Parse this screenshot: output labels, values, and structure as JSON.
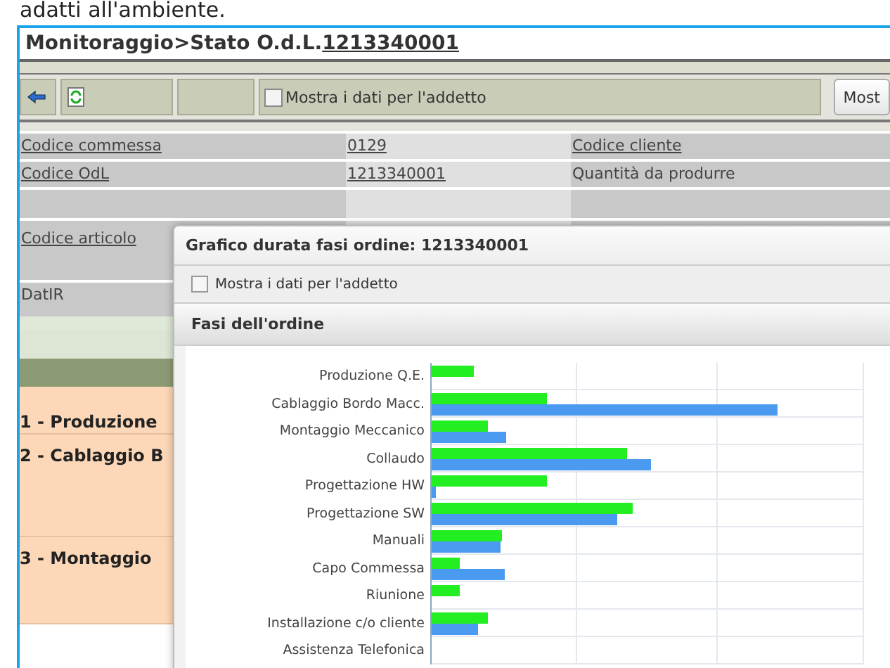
{
  "caption": "adatti all'ambiente.",
  "page_title": {
    "prefix": "Monitoraggio>Stato O.d.L.",
    "order_number": "1213340001"
  },
  "toolbar": {
    "checkbox": {
      "label": "Mostra i dati per l'addetto",
      "checked": false
    },
    "button": "Most"
  },
  "info_rows": [
    {
      "label": {
        "text": "Codice commessa",
        "linked": true
      },
      "value": "0129",
      "label_2": {
        "text": "Codice cliente",
        "linked": true
      }
    },
    {
      "label": {
        "text": "Codice OdL",
        "linked": true
      },
      "value": "1213340001",
      "label_2": {
        "text": "Quantità da produrre",
        "linked": false
      }
    },
    {},
    {
      "label": {
        "text": "Codice articolo",
        "linked": true
      }
    },
    {
      "label": {
        "text": "DatIR",
        "linked": false
      }
    }
  ],
  "phases": [
    "1 - Produzione",
    "2 - Cablaggio B",
    "3 - Montaggio"
  ],
  "dialog": {
    "title": "Grafico durata fasi ordine: 1213340001",
    "checkbox": {
      "label": "Mostra i dati per l'addetto",
      "checked": false
    },
    "section_title": "Fasi dell'ordine",
    "chart_labels": [
      "Produzione Q.E.",
      "Cablaggio Bordo Macc.",
      "Montaggio Meccanico",
      "Collaudo",
      "Progettazione HW",
      "Progettazione SW",
      "Manuali",
      "Capo Commessa",
      "Riunione",
      "Installazione c/o cliente",
      "Assistenza Telefonica"
    ]
  }
}
